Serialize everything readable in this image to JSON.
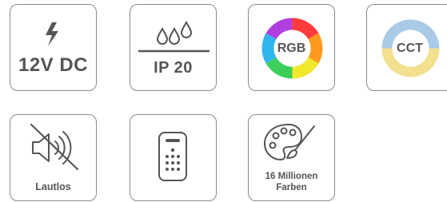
{
  "tiles": {
    "power": {
      "label": "12V DC",
      "icon": "lightning-icon"
    },
    "ip": {
      "label": "IP 20",
      "icon": "water-drops-icon"
    },
    "rgb": {
      "label": "RGB",
      "icon": "color-wheel-icon"
    },
    "cct": {
      "label": "CCT",
      "icon": "cct-circle-icon",
      "colors": {
        "top": "#a9cbe8",
        "bottom": "#f3e08f"
      }
    },
    "silent": {
      "label": "Lautlos",
      "icon": "speaker-muted-icon"
    },
    "remote": {
      "label": "",
      "icon": "remote-control-icon"
    },
    "colors": {
      "line1": "16 Millionen",
      "line2": "Farben",
      "icon": "paint-palette-icon"
    }
  },
  "colors": {
    "border": "#8a8a8a",
    "icon": "#555555"
  }
}
